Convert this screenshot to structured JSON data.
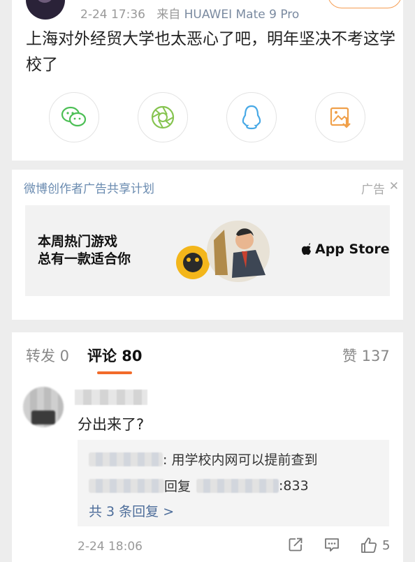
{
  "post": {
    "time": "2-24 17:36",
    "source_prefix": "来自",
    "device": "HUAWEI Mate 9 Pro",
    "text": "上海对外经贸大学也太恶心了吧，明年坚决不考这学校了",
    "share_buttons": [
      {
        "icon": "wechat-icon",
        "color": "#4cbf55"
      },
      {
        "icon": "moments-icon",
        "color": "#86c450"
      },
      {
        "icon": "qq-icon",
        "color": "#48a9e6"
      },
      {
        "icon": "save-image-icon",
        "color": "#f0a04a"
      }
    ]
  },
  "ad": {
    "title": "微博创作者广告共享计划",
    "label": "广告",
    "close": "✕",
    "slogan_line1": "本周热门游戏",
    "slogan_line2": "总有一款适合你",
    "store": "App Store"
  },
  "tabs": {
    "repost": "转发 0",
    "comment": "评论 80",
    "like": "赞 137",
    "accent": "#f26b2a"
  },
  "comment": {
    "text": "分出来了?",
    "reply1": ": 用学校内网可以提前查到",
    "reply2_mid": "回复",
    "reply2_end": ":833",
    "more": "共 3 条回复 >",
    "time": "2-24 18:06",
    "likes": "5"
  }
}
